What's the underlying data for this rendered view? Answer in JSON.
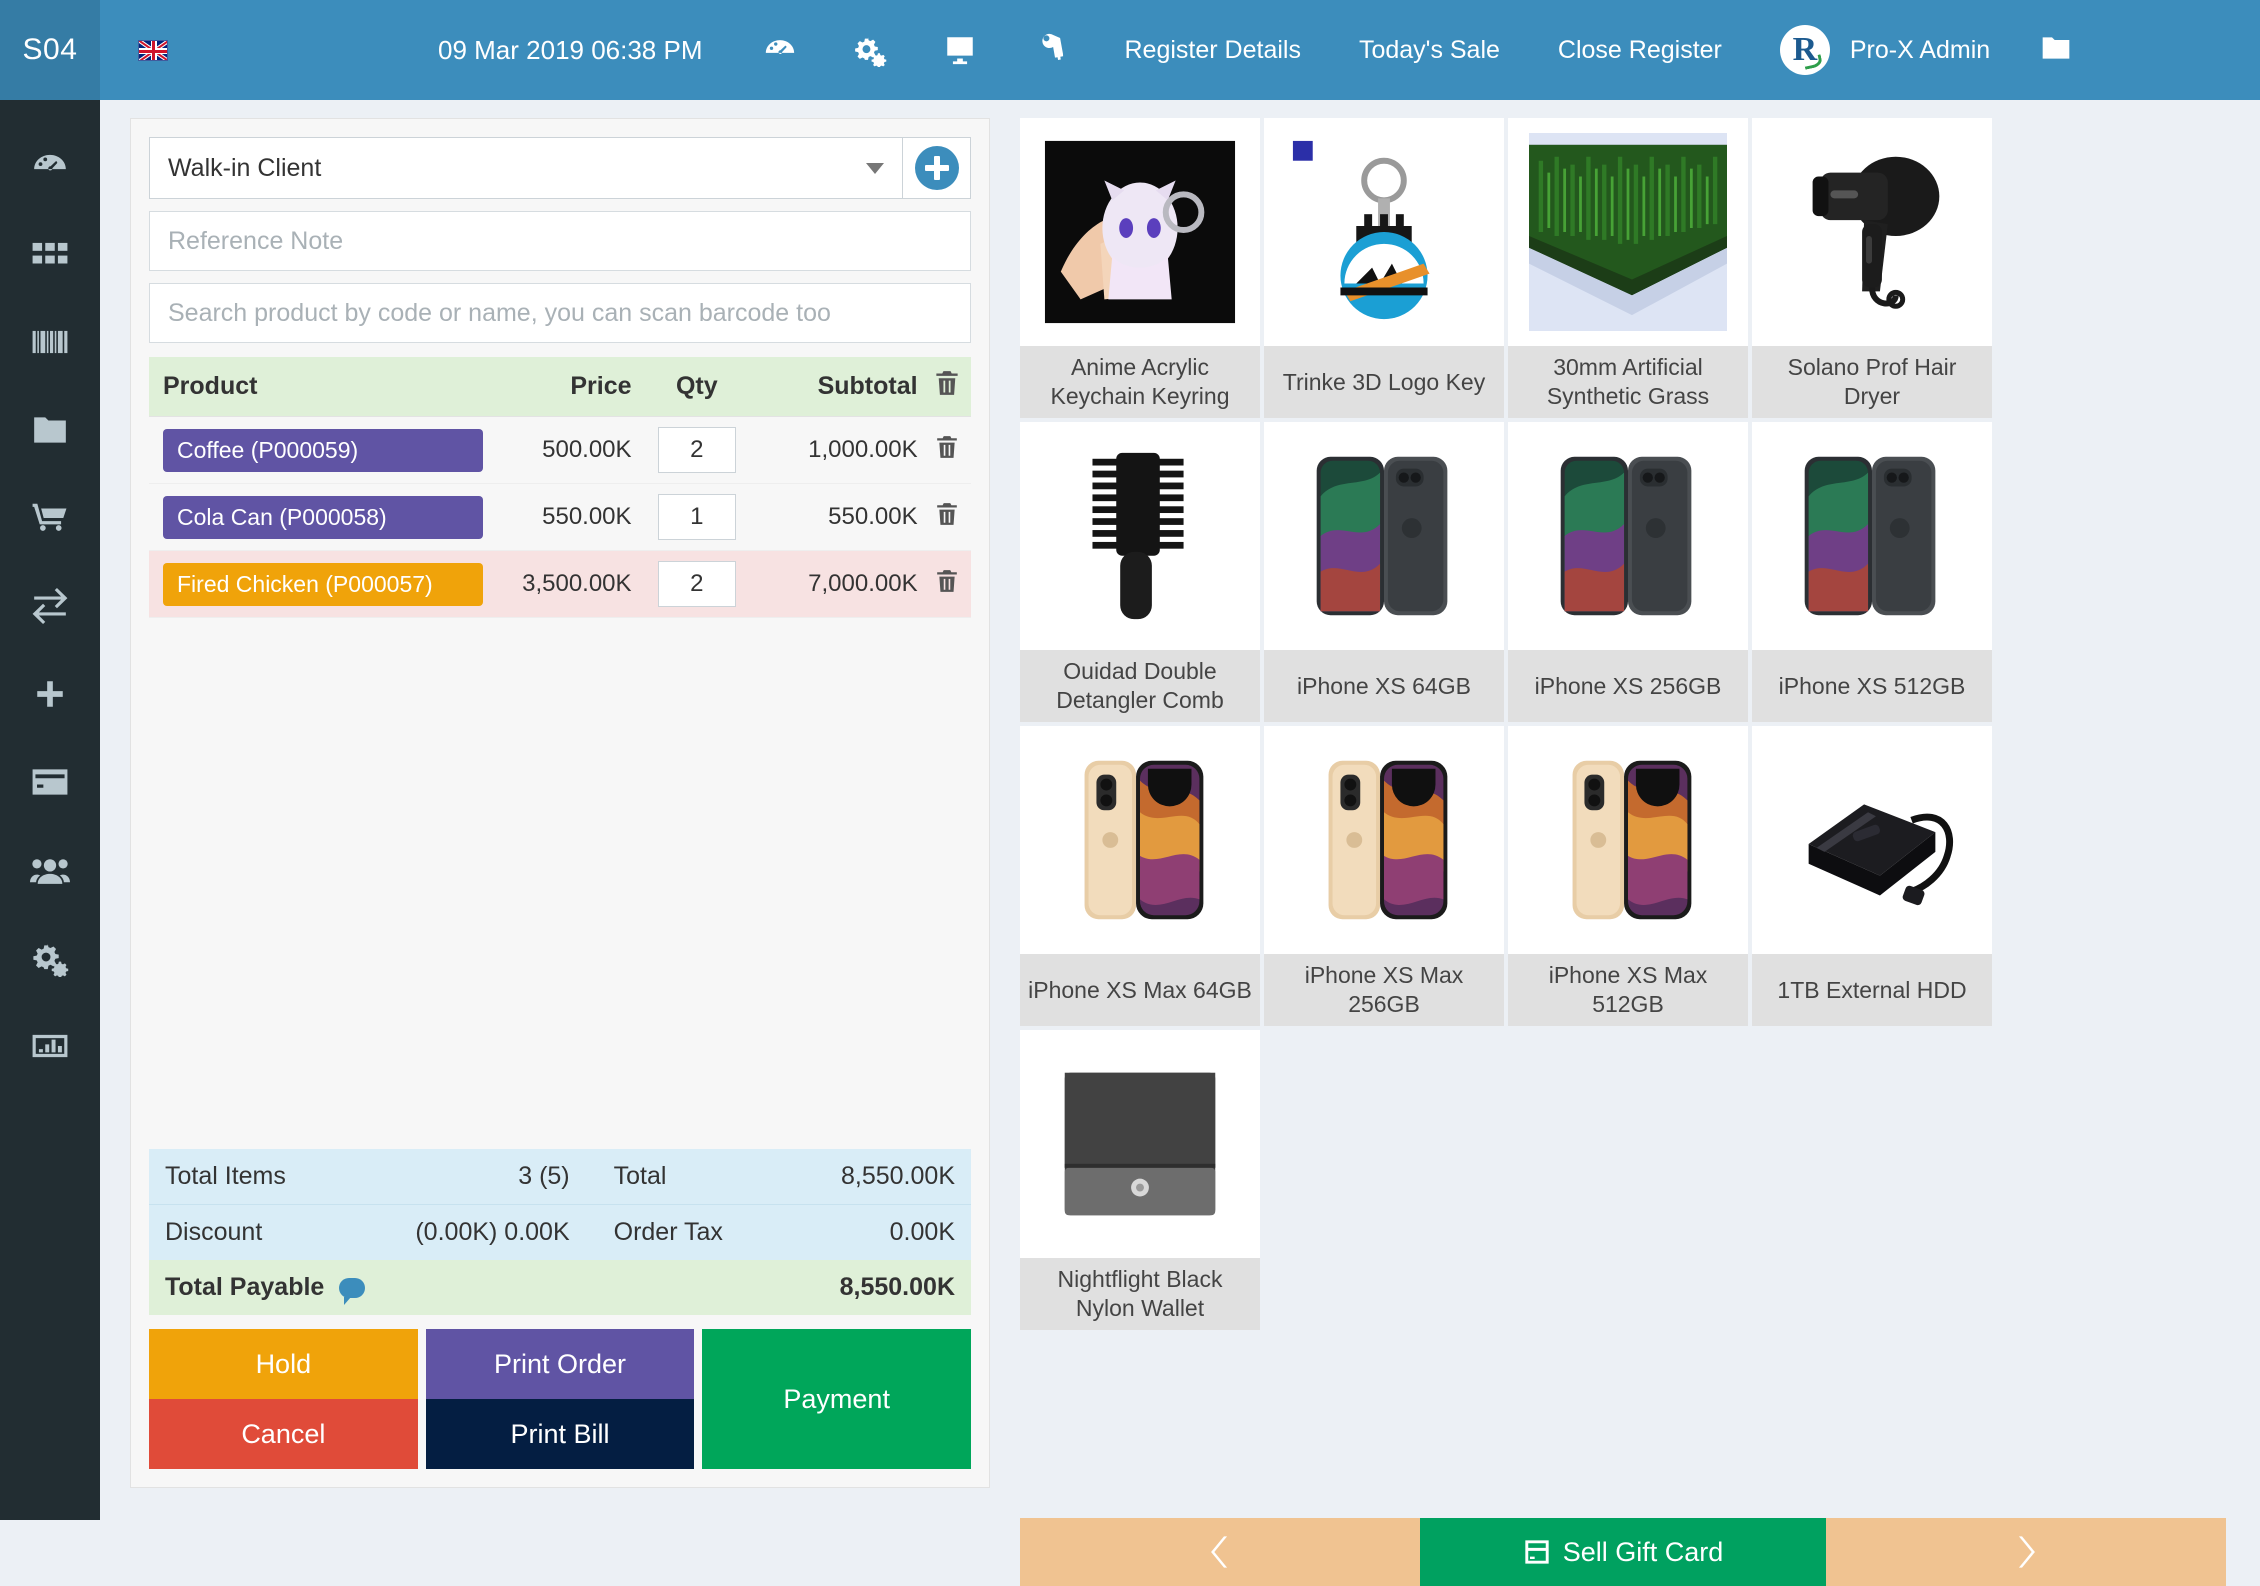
{
  "header": {
    "store_code": "S04",
    "language_flag": "uk-flag-icon",
    "datetime": "09 Mar 2019 06:38 PM",
    "icons": [
      "dashboard-icon",
      "settings-cogs-icon",
      "monitor-icon",
      "key-icon"
    ],
    "links": [
      {
        "label": "Register Details"
      },
      {
        "label": "Today's Sale"
      },
      {
        "label": "Close Register"
      }
    ],
    "user_name": "Pro-X Admin",
    "folder_icon": "folder-icon"
  },
  "sidebar": {
    "items": [
      {
        "name": "dashboard",
        "icon": "dashboard-icon"
      },
      {
        "name": "products-grid",
        "icon": "grid-icon"
      },
      {
        "name": "barcode",
        "icon": "barcode-icon"
      },
      {
        "name": "files",
        "icon": "folder-icon"
      },
      {
        "name": "sales-cart",
        "icon": "cart-icon"
      },
      {
        "name": "transfers",
        "icon": "exchange-icon"
      },
      {
        "name": "add-new",
        "icon": "plus-icon"
      },
      {
        "name": "payments",
        "icon": "credit-card-icon"
      },
      {
        "name": "customers",
        "icon": "users-icon"
      },
      {
        "name": "settings",
        "icon": "cogs-icon"
      },
      {
        "name": "reports",
        "icon": "bar-chart-icon"
      }
    ]
  },
  "order_form": {
    "customer_value": "Walk-in Client",
    "add_customer_icon": "plus-circle-icon",
    "reference_note_placeholder": "Reference Note",
    "reference_note_value": "",
    "product_search_placeholder": "Search product by code or name, you can scan barcode too",
    "product_search_value": ""
  },
  "cart": {
    "columns": [
      "Product",
      "Price",
      "Qty",
      "Subtotal"
    ],
    "delete_all_icon": "trash-icon",
    "rows": [
      {
        "product": "Coffee (P000059)",
        "badge_color": "#6054a4",
        "price": "500.00K",
        "qty": "2",
        "subtotal": "1,000.00K",
        "highlight": false
      },
      {
        "product": "Cola Can (P000058)",
        "badge_color": "#6054a4",
        "price": "550.00K",
        "qty": "1",
        "subtotal": "550.00K",
        "highlight": false
      },
      {
        "product": "Fired Chicken (P000057)",
        "badge_color": "#f0a30a",
        "price": "3,500.00K",
        "qty": "2",
        "subtotal": "7,000.00K",
        "highlight": true
      }
    ]
  },
  "totals": {
    "total_items_label": "Total Items",
    "total_items_value": "3 (5)",
    "total_label": "Total",
    "total_value": "8,550.00K",
    "discount_label": "Discount",
    "discount_value": "(0.00K) 0.00K",
    "order_tax_label": "Order Tax",
    "order_tax_value": "0.00K",
    "total_payable_label": "Total Payable",
    "total_payable_icon": "comment-bubble-icon",
    "total_payable_value": "8,550.00K"
  },
  "actions": {
    "hold": "Hold",
    "cancel": "Cancel",
    "print_order": "Print Order",
    "print_bill": "Print Bill",
    "payment": "Payment"
  },
  "products": [
    {
      "name": "Anime Acrylic Keychain Keyring",
      "art": "keychain"
    },
    {
      "name": "Trinke 3D Logo Key",
      "art": "logokey"
    },
    {
      "name": "30mm Artificial Synthetic Grass",
      "art": "grass"
    },
    {
      "name": "Solano Prof Hair Dryer",
      "art": "hairdryer"
    },
    {
      "name": "Ouidad Double Detangler Comb",
      "art": "comb"
    },
    {
      "name": "iPhone XS 64GB",
      "art": "iphone-gray"
    },
    {
      "name": "iPhone XS 256GB",
      "art": "iphone-gray"
    },
    {
      "name": "iPhone XS 512GB",
      "art": "iphone-gray"
    },
    {
      "name": "iPhone XS Max 64GB",
      "art": "iphone-gold"
    },
    {
      "name": "iPhone XS Max 256GB",
      "art": "iphone-gold"
    },
    {
      "name": "iPhone XS Max 512GB",
      "art": "iphone-gold"
    },
    {
      "name": "1TB External HDD",
      "art": "hdd"
    },
    {
      "name": "Nightflight Black Nylon Wallet",
      "art": "wallet"
    }
  ],
  "pager": {
    "prev_icon": "chevron-left-icon",
    "next_icon": "chevron-right-icon",
    "gift_card_label": "Sell Gift Card",
    "gift_card_icon": "gift-card-icon"
  },
  "colors": {
    "header_blue": "#3c8dbc",
    "sidebar_dark": "#222d32",
    "badge_purple": "#6054a4",
    "badge_orange": "#f0a30a",
    "danger_red": "#e04b39",
    "success_green": "#00a65a",
    "navy": "#041e42",
    "pager_tan": "#f0c391",
    "totals_blue": "#d9edf7",
    "totals_green": "#dff0d8"
  }
}
